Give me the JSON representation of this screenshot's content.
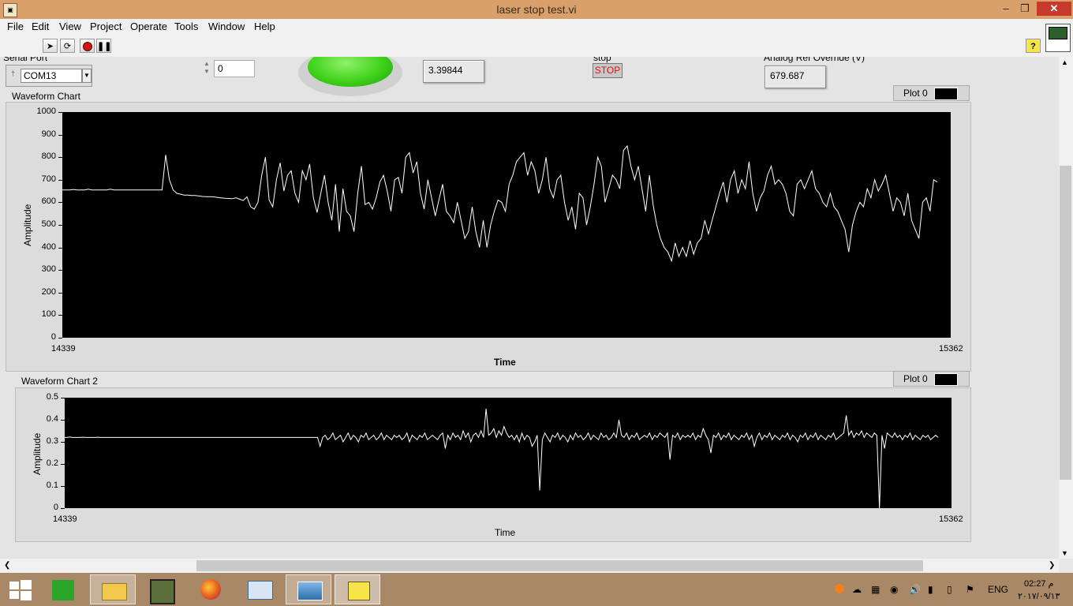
{
  "window": {
    "title": "laser stop test.vi",
    "min_symbol": "–",
    "restore_symbol": "❐",
    "close_symbol": "✕"
  },
  "menu": [
    "File",
    "Edit",
    "View",
    "Project",
    "Operate",
    "Tools",
    "Window",
    "Help"
  ],
  "toolbar": {
    "run_icon": "run-arrow-icon",
    "run_continuous_icon": "run-continuously-icon",
    "abort_icon": "abort-icon",
    "pause_icon": "pause-icon",
    "help_symbol": "?"
  },
  "panel": {
    "serial_port_label": "Serial Port",
    "serial_port_value": "COM13",
    "numeric_value": "0",
    "reading_value": "3.39844",
    "stop_label": "stop",
    "stop_button": "STOP",
    "analog_ref_label": "Analog Ref Override (V)",
    "analog_ref_value": "679.687",
    "led_color": "#3fd21a"
  },
  "chart_data": [
    {
      "type": "line",
      "title": "Waveform Chart",
      "xlabel": "Time",
      "ylabel": "Amplitude",
      "x_range": [
        14339,
        15362
      ],
      "ylim": [
        0,
        1000
      ],
      "yticks": [
        "1000",
        "900",
        "800",
        "700",
        "600",
        "500",
        "400",
        "300",
        "200",
        "100",
        "0"
      ],
      "xticks": [
        "14339",
        "15362"
      ],
      "legend": "Plot 0",
      "background": "#000000",
      "line_color": "#ffffff",
      "series": [
        {
          "name": "Plot 0",
          "values": [
            655,
            655,
            655,
            657,
            655,
            655,
            655,
            658,
            655,
            655,
            655,
            655,
            655,
            658,
            655,
            655,
            655,
            655,
            655,
            655,
            655,
            655,
            655,
            655,
            655,
            655,
            655,
            655,
            810,
            700,
            655,
            640,
            636,
            632,
            632,
            630,
            630,
            628,
            626,
            625,
            625,
            624,
            622,
            620,
            618,
            617,
            616,
            620,
            614,
            608,
            624,
            580,
            570,
            600,
            720,
            800,
            610,
            580,
            700,
            775,
            650,
            720,
            740,
            640,
            600,
            740,
            700,
            770,
            620,
            555,
            640,
            720,
            600,
            520,
            680,
            470,
            660,
            560,
            540,
            470,
            640,
            760,
            590,
            600,
            570,
            620,
            690,
            720,
            650,
            560,
            700,
            710,
            640,
            800,
            820,
            730,
            780,
            640,
            570,
            700,
            620,
            540,
            610,
            680,
            560,
            540,
            510,
            600,
            520,
            440,
            470,
            580,
            470,
            400,
            520,
            400,
            500,
            560,
            610,
            600,
            560,
            680,
            720,
            780,
            800,
            820,
            720,
            780,
            740,
            640,
            700,
            800,
            660,
            620,
            700,
            720,
            600,
            520,
            580,
            480,
            640,
            620,
            500,
            580,
            680,
            800,
            760,
            600,
            660,
            720,
            700,
            660,
            830,
            850,
            760,
            700,
            760,
            660,
            560,
            720,
            590,
            500,
            440,
            400,
            380,
            340,
            420,
            360,
            400,
            360,
            430,
            370,
            420,
            440,
            520,
            460,
            520,
            580,
            640,
            690,
            600,
            700,
            740,
            640,
            700,
            660,
            780,
            640,
            560,
            620,
            650,
            720,
            760,
            680,
            700,
            680,
            640,
            560,
            540,
            680,
            700,
            660,
            700,
            740,
            660,
            640,
            600,
            580,
            640,
            580,
            560,
            520,
            480,
            380,
            500,
            560,
            600,
            580,
            660,
            620,
            700,
            650,
            680,
            720,
            640,
            560,
            620,
            600,
            540,
            640,
            520,
            480,
            440,
            600,
            620,
            560,
            700,
            690
          ]
        }
      ]
    },
    {
      "type": "line",
      "title": "Waveform Chart 2",
      "xlabel": "Time",
      "ylabel": "Amplitude",
      "x_range": [
        14339,
        15362
      ],
      "ylim": [
        0,
        0.5
      ],
      "yticks": [
        "0.5",
        "0.4",
        "0.3",
        "0.2",
        "0.1",
        "0"
      ],
      "xticks": [
        "14339",
        "15362"
      ],
      "legend": "Plot 0",
      "background": "#000000",
      "line_color": "#ffffff",
      "series": [
        {
          "name": "Plot 0",
          "values": [
            0.32,
            0.32,
            0.322,
            0.32,
            0.32,
            0.32,
            0.32,
            0.321,
            0.32,
            0.32,
            0.32,
            0.32,
            0.32,
            0.321,
            0.32,
            0.32,
            0.32,
            0.32,
            0.32,
            0.32,
            0.32,
            0.32,
            0.32,
            0.32,
            0.32,
            0.32,
            0.32,
            0.32,
            0.32,
            0.32,
            0.32,
            0.32,
            0.32,
            0.32,
            0.32,
            0.32,
            0.32,
            0.32,
            0.32,
            0.32,
            0.32,
            0.32,
            0.32,
            0.32,
            0.32,
            0.32,
            0.32,
            0.32,
            0.32,
            0.32,
            0.32,
            0.32,
            0.32,
            0.32,
            0.32,
            0.32,
            0.32,
            0.32,
            0.32,
            0.32,
            0.32,
            0.32,
            0.32,
            0.32,
            0.32,
            0.32,
            0.32,
            0.32,
            0.32,
            0.32,
            0.32,
            0.32,
            0.32,
            0.32,
            0.32,
            0.32,
            0.32,
            0.32,
            0.32,
            0.32,
            0.32,
            0.32,
            0.32,
            0.32,
            0.32,
            0.32,
            0.32,
            0.32,
            0.32,
            0.32,
            0.32,
            0.32,
            0.32,
            0.32,
            0.32,
            0.32,
            0.32,
            0.32,
            0.32,
            0.32,
            0.28,
            0.32,
            0.33,
            0.31,
            0.32,
            0.34,
            0.31,
            0.32,
            0.33,
            0.3,
            0.32,
            0.34,
            0.31,
            0.33,
            0.32,
            0.3,
            0.33,
            0.32,
            0.34,
            0.31,
            0.32,
            0.33,
            0.31,
            0.32,
            0.34,
            0.31,
            0.33,
            0.32,
            0.31,
            0.33,
            0.32,
            0.33,
            0.31,
            0.32,
            0.34,
            0.3,
            0.33,
            0.32,
            0.31,
            0.33,
            0.32,
            0.34,
            0.31,
            0.32,
            0.33,
            0.32,
            0.31,
            0.33,
            0.34,
            0.27,
            0.33,
            0.31,
            0.34,
            0.32,
            0.33,
            0.31,
            0.35,
            0.32,
            0.34,
            0.3,
            0.33,
            0.34,
            0.32,
            0.35,
            0.32,
            0.45,
            0.33,
            0.34,
            0.36,
            0.32,
            0.35,
            0.33,
            0.37,
            0.34,
            0.32,
            0.33,
            0.31,
            0.33,
            0.3,
            0.34,
            0.31,
            0.33,
            0.32,
            0.28,
            0.3,
            0.33,
            0.08,
            0.31,
            0.34,
            0.32,
            0.3,
            0.33,
            0.32,
            0.34,
            0.31,
            0.33,
            0.32,
            0.3,
            0.33,
            0.31,
            0.34,
            0.32,
            0.33,
            0.31,
            0.32,
            0.34,
            0.31,
            0.33,
            0.32,
            0.31,
            0.34,
            0.32,
            0.33,
            0.31,
            0.32,
            0.34,
            0.32,
            0.4,
            0.33,
            0.32,
            0.34,
            0.31,
            0.33,
            0.32,
            0.34,
            0.31,
            0.32,
            0.33,
            0.32,
            0.34,
            0.31,
            0.33,
            0.32,
            0.34,
            0.33,
            0.32,
            0.34,
            0.22,
            0.33,
            0.32,
            0.34,
            0.31,
            0.33,
            0.32,
            0.33,
            0.32,
            0.34,
            0.31,
            0.33,
            0.32,
            0.36,
            0.33,
            0.31,
            0.25,
            0.33,
            0.32,
            0.34,
            0.31,
            0.33,
            0.32,
            0.34,
            0.31,
            0.33,
            0.32,
            0.31,
            0.33,
            0.32,
            0.34,
            0.31,
            0.33,
            0.28,
            0.32,
            0.34,
            0.31,
            0.33,
            0.32,
            0.34,
            0.31,
            0.33,
            0.32,
            0.31,
            0.33,
            0.32,
            0.34,
            0.31,
            0.33,
            0.32,
            0.3,
            0.33,
            0.32,
            0.34,
            0.31,
            0.33,
            0.32,
            0.34,
            0.31,
            0.33,
            0.32,
            0.31,
            0.33,
            0.32,
            0.34,
            0.31,
            0.32,
            0.33,
            0.34,
            0.42,
            0.33,
            0.35,
            0.32,
            0.34,
            0.33,
            0.35,
            0.32,
            0.34,
            0.33,
            0.32,
            0.34,
            0.33,
            0.0,
            0.33,
            0.27,
            0.34,
            0.33,
            0.32,
            0.34,
            0.32,
            0.33,
            0.31,
            0.33,
            0.32,
            0.34,
            0.31,
            0.33,
            0.32,
            0.31,
            0.33,
            0.32,
            0.33,
            0.31,
            0.32,
            0.33,
            0.32
          ]
        }
      ]
    }
  ],
  "taskbar": {
    "items": [
      "start-windows-icon",
      "store-icon",
      "file-explorer-icon",
      "photo-app-icon",
      "firefox-icon",
      "keyboard-utility-icon",
      "photo-viewer-icon",
      "labview-icon"
    ],
    "lang": "ENG",
    "time": "02:27 م",
    "date": "٢٠١٧/٠٩/١٣",
    "tray_icons": [
      "avast-icon",
      "onedrive-icon",
      "keyboard-icon",
      "record-icon",
      "volume-icon",
      "network-icon",
      "power-icon",
      "flag-icon"
    ]
  }
}
